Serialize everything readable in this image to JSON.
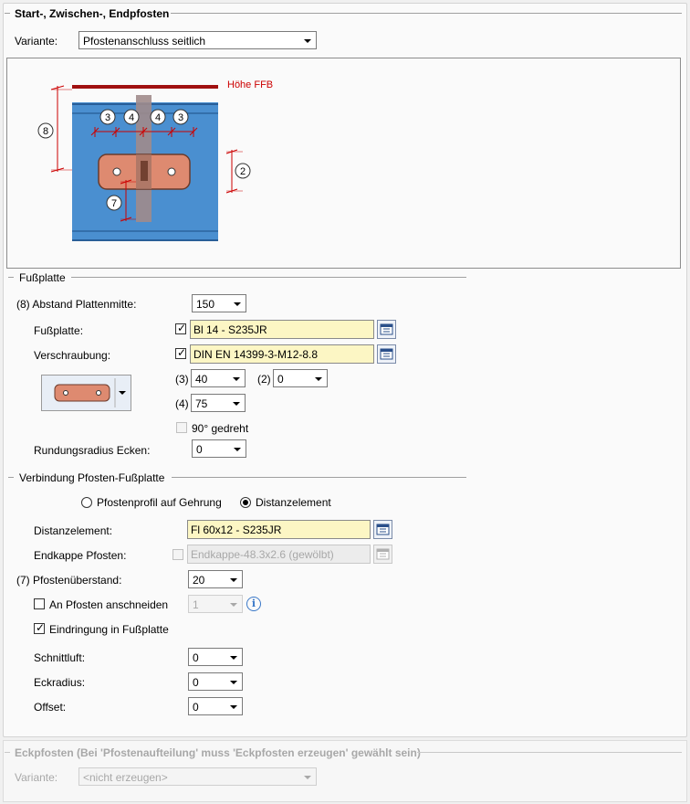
{
  "section_main": {
    "title": "Start-, Zwischen-, Endpfosten"
  },
  "variante": {
    "label": "Variante:",
    "value": "Pfostenanschluss seitlich"
  },
  "preview": {
    "hoehe_label": "Höhe FFB",
    "markers": {
      "m8": "8",
      "m3a": "3",
      "m4a": "4",
      "m4b": "4",
      "m3b": "3",
      "m2": "2",
      "m7": "7"
    },
    "colors": {
      "red": "#cc0000",
      "blue": "#4a8fd0",
      "plate": "#de8a70",
      "post": "#a08b8b"
    }
  },
  "fussplatte": {
    "title": "Fußplatte",
    "abstand_label": "(8) Abstand Plattenmitte:",
    "abstand_value": "150",
    "fussplatte_label": "Fußplatte:",
    "fussplatte_value": "Bl 14 - S235JR",
    "fussplatte_checked": true,
    "verschraubung_label": "Verschraubung:",
    "verschraubung_value": "DIN EN 14399-3-M12-8.8",
    "verschraubung_checked": true,
    "p3_label": "(3)",
    "p3_value": "40",
    "p2_label": "(2)",
    "p2_value": "0",
    "p4_label": "(4)",
    "p4_value": "75",
    "gedreht_label": "90° gedreht",
    "gedreht_checked": false,
    "rundung_label": "Rundungsradius Ecken:",
    "rundung_value": "0"
  },
  "verbindung": {
    "title": "Verbindung Pfosten-Fußplatte",
    "radio1_label": "Pfostenprofil auf Gehrung",
    "radio2_label": "Distanzelement",
    "selected": "Distanzelement",
    "distanz_label": "Distanzelement:",
    "distanz_value": "Fl 60x12 - S235JR",
    "endkappe_label": "Endkappe Pfosten:",
    "endkappe_value": "Endkappe-48.3x2.6 (gewölbt)",
    "ueberstand_label": "(7) Pfostenüberstand:",
    "ueberstand_value": "20",
    "anschneiden_label": "An Pfosten anschneiden",
    "anschneiden_value": "1",
    "eindringung_label": "Eindringung in Fußplatte",
    "eindringung_checked": true,
    "schnittluft_label": "Schnittluft:",
    "schnittluft_value": "0",
    "eckradius_label": "Eckradius:",
    "eckradius_value": "0",
    "offset_label": "Offset:",
    "offset_value": "0"
  },
  "eckpfosten": {
    "title": "Eckpfosten (Bei 'Pfostenaufteilung' muss 'Eckpfosten erzeugen' gewählt sein)",
    "variante_label": "Variante:",
    "variante_value": "<nicht erzeugen>"
  }
}
